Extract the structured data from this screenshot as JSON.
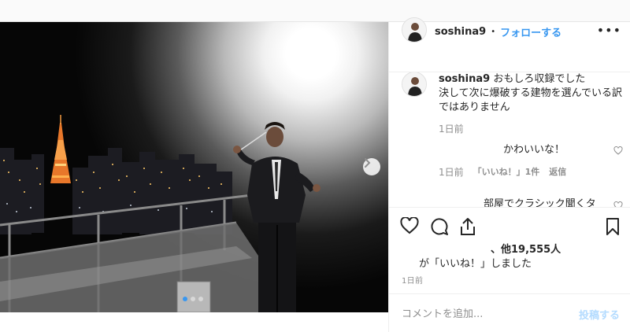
{
  "header": {
    "username": "soshina9",
    "separator": "•",
    "follow_label": "フォローする",
    "more_label": "•••"
  },
  "caption": {
    "username": "soshina9",
    "lines": [
      "おもしろ収録でした",
      "決して次に爆破する建物を選んでいる訳",
      "ではありません"
    ],
    "time": "1日前"
  },
  "comments": [
    {
      "text": "かわいいな！",
      "time": "1日前",
      "likes": "「いいね！」1件",
      "reply_label": "返信"
    },
    {
      "text": "部屋でクラシック聞くタ"
    }
  ],
  "actions": {
    "like_icon": "heart-icon",
    "comment_icon": "comment-icon",
    "share_icon": "share-icon",
    "save_icon": "bookmark-icon"
  },
  "likes": {
    "count_text": "、他19,555人",
    "liked_by_text": "が「いいね！」しました",
    "time": "1日前"
  },
  "add_comment": {
    "placeholder": "コメントを追加...",
    "post_label": "投稿する"
  },
  "carousel": {
    "total": 3,
    "active": 1
  },
  "colors": {
    "accent": "#3897f0",
    "post_disabled": "#b3dbff",
    "muted": "#8e8e8e",
    "border": "#efefef"
  }
}
